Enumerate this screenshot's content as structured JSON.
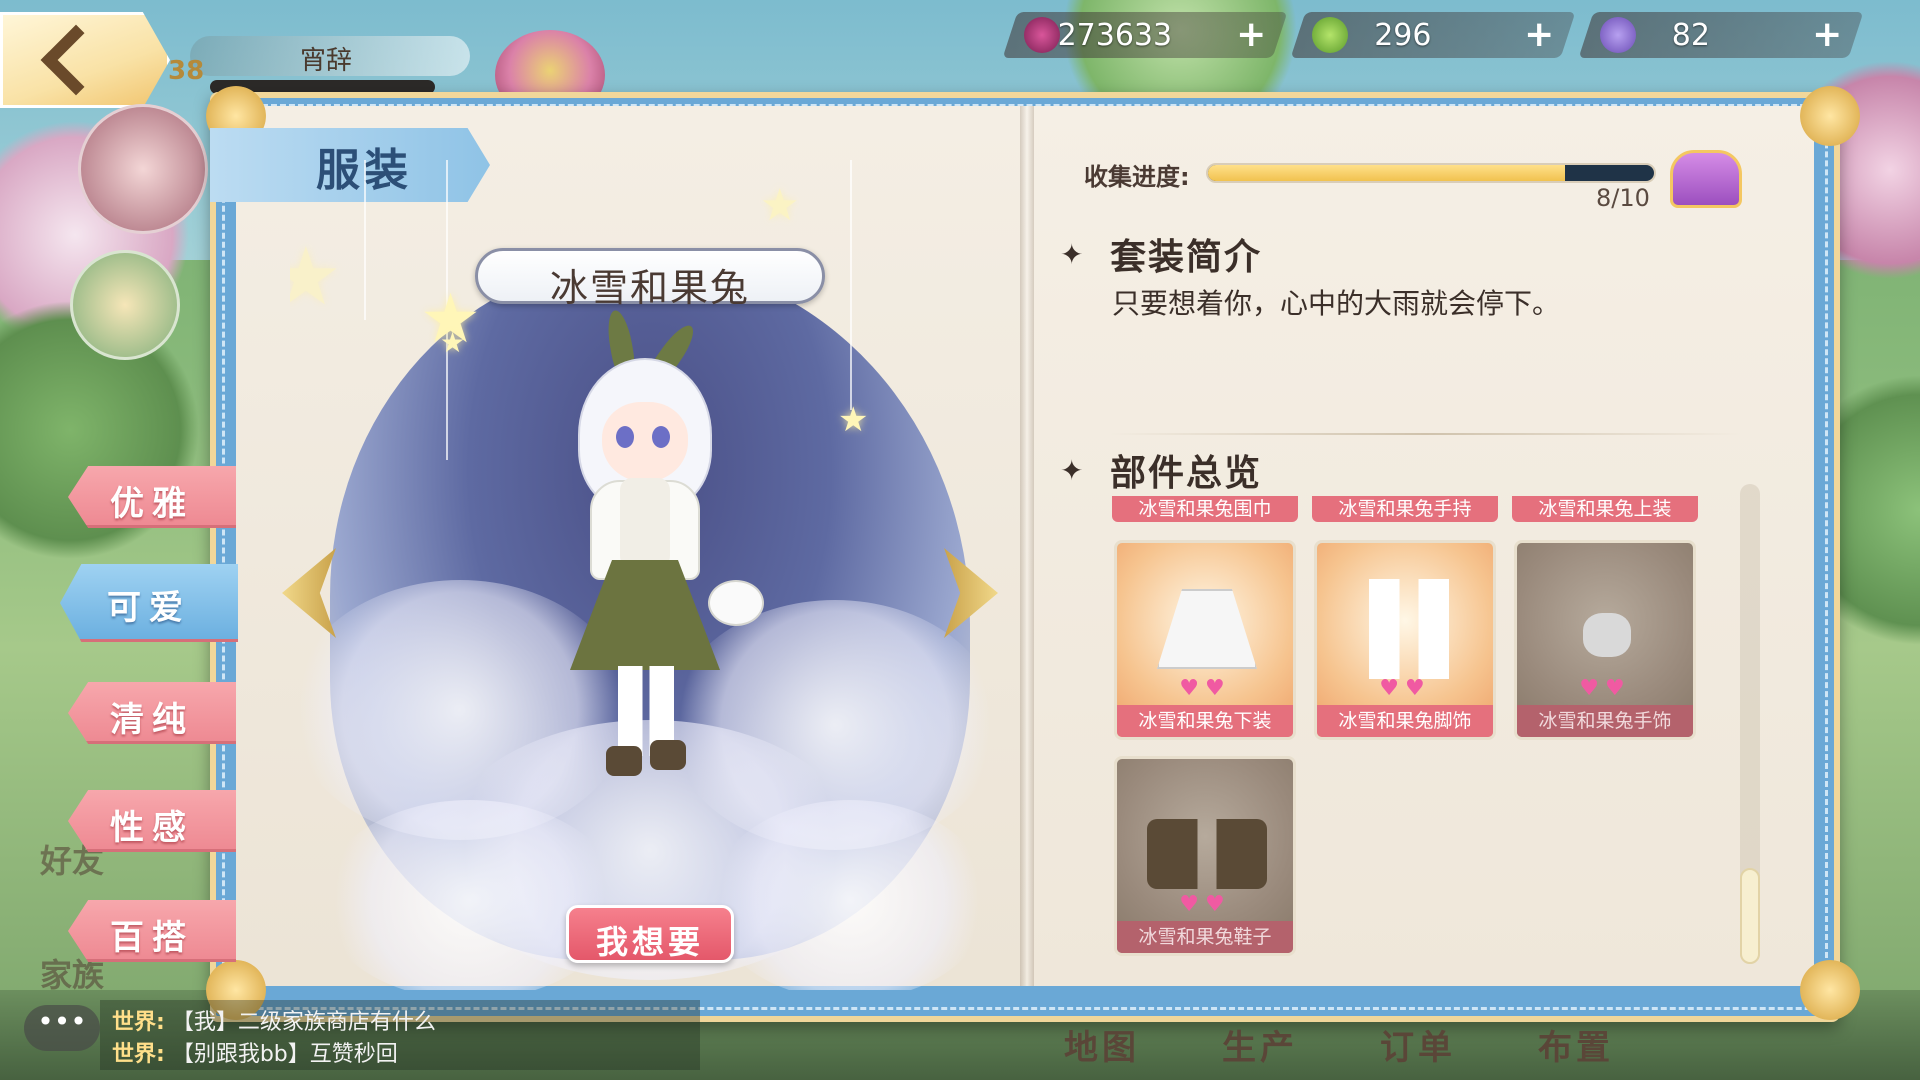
{
  "hud": {
    "player_name": "宵辞",
    "player_level": "38",
    "currencies": [
      {
        "name": "berries",
        "icon": "berry-icon",
        "value": "273633",
        "color": "#a12a6e"
      },
      {
        "name": "leaves",
        "icon": "leaf-icon",
        "value": "296",
        "color": "#7fbf3a"
      },
      {
        "name": "grapes",
        "icon": "grape-icon",
        "value": "82",
        "color": "#8f6fd6"
      }
    ],
    "plus": "+"
  },
  "panel": {
    "title": "服装",
    "tabs": [
      "优雅",
      "可爱",
      "清纯",
      "性感",
      "百搭"
    ],
    "active_tab": "可爱"
  },
  "outfit": {
    "name": "冰雪和果兔",
    "want_button": "我想要"
  },
  "collection": {
    "label": "收集进度:",
    "current": 8,
    "total": 10,
    "count_text": "8/10"
  },
  "intro": {
    "heading": "套装简介",
    "text": "只要想着你，心中的大雨就会停下。"
  },
  "parts": {
    "heading": "部件总览",
    "top_row": [
      "冰雪和果兔围巾",
      "冰雪和果兔手持",
      "冰雪和果兔上装"
    ],
    "cards": [
      {
        "label": "冰雪和果兔下装",
        "owned": true,
        "icon": "skirt-icon"
      },
      {
        "label": "冰雪和果兔脚饰",
        "owned": true,
        "icon": "socks-icon"
      },
      {
        "label": "冰雪和果兔手饰",
        "owned": false,
        "icon": "bracelet-icon"
      },
      {
        "label": "冰雪和果兔鞋子",
        "owned": false,
        "icon": "shoes-icon"
      }
    ],
    "hearts": "♥♥"
  },
  "side": {
    "friends": "好友",
    "family": "家族"
  },
  "chat": {
    "bubble": "•••",
    "lines": [
      {
        "channel": "世界:",
        "text": "【我】二级家族商店有什么"
      },
      {
        "channel": "世界:",
        "text": "【别跟我bb】互赞秒回"
      }
    ]
  },
  "bottom_nav": [
    "地图",
    "生产",
    "订单",
    "布置"
  ]
}
